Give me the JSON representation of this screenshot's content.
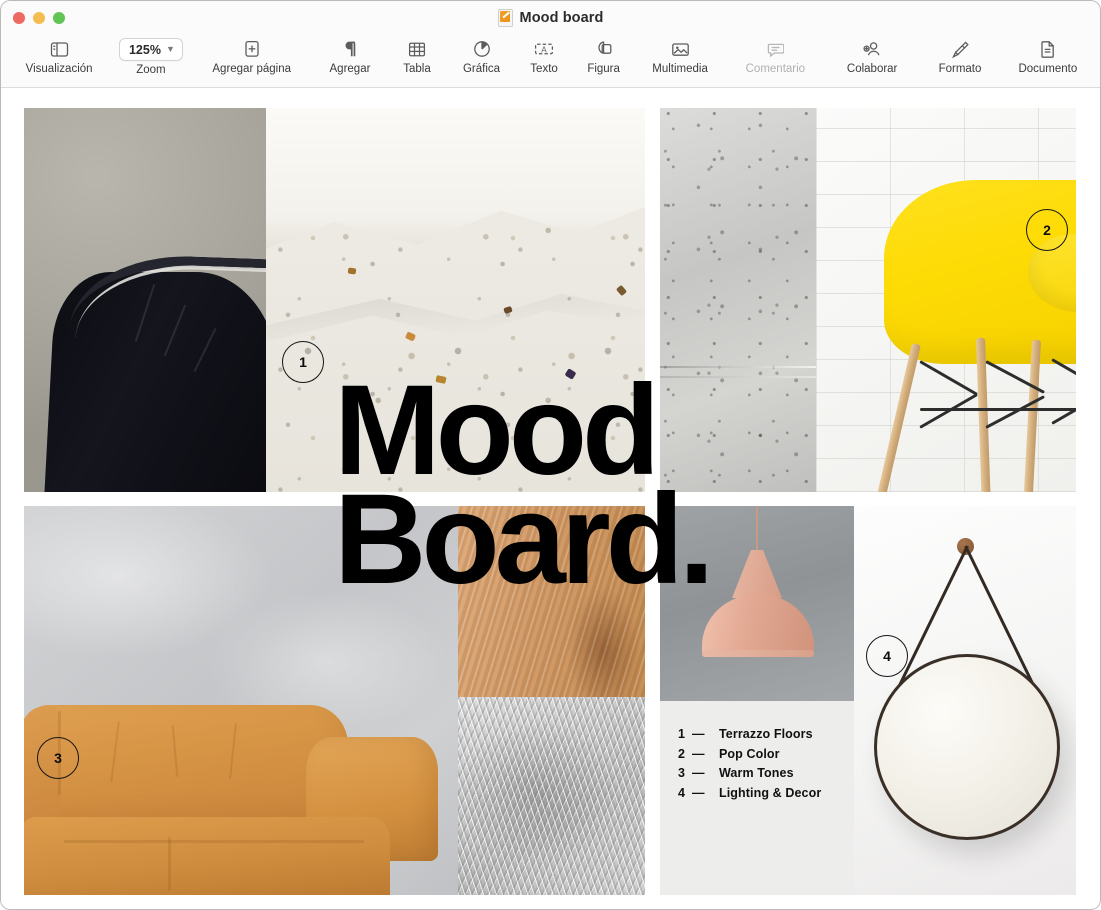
{
  "window": {
    "title": "Mood board",
    "doc_icon": "pages-document-icon",
    "controls": [
      {
        "name": "close",
        "color": "#ec6a5f"
      },
      {
        "name": "minimize",
        "color": "#f4bd50"
      },
      {
        "name": "zoom",
        "color": "#61c454"
      }
    ]
  },
  "toolbar": {
    "items": [
      {
        "label": "Visualización",
        "icon": "sidebar-icon",
        "type": "button",
        "disabled": false
      },
      {
        "label": "Zoom",
        "icon": "zoom-popup",
        "type": "popup",
        "value": "125%",
        "disabled": false
      },
      {
        "label": "Agregar página",
        "icon": "add-page-icon",
        "type": "button",
        "disabled": false
      },
      {
        "label": "Agregar",
        "icon": "pilcrow-icon",
        "type": "button",
        "disabled": false
      },
      {
        "label": "Tabla",
        "icon": "table-icon",
        "type": "button",
        "disabled": false
      },
      {
        "label": "Gráfica",
        "icon": "chart-pie-icon",
        "type": "button",
        "disabled": false
      },
      {
        "label": "Texto",
        "icon": "text-box-icon",
        "type": "button",
        "disabled": false
      },
      {
        "label": "Figura",
        "icon": "shapes-icon",
        "type": "button",
        "disabled": false
      },
      {
        "label": "Multimedia",
        "icon": "media-icon",
        "type": "button",
        "disabled": false
      },
      {
        "label": "Comentario",
        "icon": "comment-icon",
        "type": "button",
        "disabled": true
      },
      {
        "label": "Colaborar",
        "icon": "collaborate-icon",
        "type": "button",
        "disabled": false
      },
      {
        "label": "Formato",
        "icon": "format-brush-icon",
        "type": "button",
        "disabled": false
      },
      {
        "label": "Documento",
        "icon": "document-icon",
        "type": "button",
        "disabled": false
      }
    ]
  },
  "document": {
    "heading_line1": "Mood",
    "heading_line2": "Board.",
    "badges": [
      {
        "number": "1",
        "refers_to": "Terrazzo Floors"
      },
      {
        "number": "2",
        "refers_to": "Pop Color"
      },
      {
        "number": "3",
        "refers_to": "Warm Tones"
      },
      {
        "number": "4",
        "refers_to": "Lighting & Decor"
      }
    ],
    "legend": {
      "dash": "—",
      "rows": [
        {
          "num": "1",
          "label": "Terrazzo Floors"
        },
        {
          "num": "2",
          "label": "Pop Color"
        },
        {
          "num": "3",
          "label": "Warm Tones"
        },
        {
          "num": "4",
          "label": "Lighting & Decor"
        }
      ]
    },
    "images": [
      {
        "name": "black-leather-chair-photo",
        "alt": "Black leather armchair on grey background"
      },
      {
        "name": "terrazzo-slab-photo",
        "alt": "White terrazzo stone slab close-up"
      },
      {
        "name": "concrete-wall-photo",
        "alt": "Grey concrete wall texture"
      },
      {
        "name": "yellow-chair-photo",
        "alt": "Yellow moulded chair with wooden legs against white brick"
      },
      {
        "name": "grey-plaster-wall-photo",
        "alt": "Grey plaster wall"
      },
      {
        "name": "tan-leather-sofa-photo",
        "alt": "Tan leather sofa"
      },
      {
        "name": "wood-grain-photo",
        "alt": "Warm oak wood grain"
      },
      {
        "name": "grey-fur-rug-photo",
        "alt": "Grey sheepskin fur rug"
      },
      {
        "name": "pink-pendant-lamp-photo",
        "alt": "Blush pink pendant lamp on grey"
      },
      {
        "name": "round-strap-mirror-photo",
        "alt": "Round mirror with leather strap on white wall"
      }
    ]
  },
  "colors": {
    "pop_yellow": "#fcd905",
    "warm_tan": "#d1903f",
    "blush": "#e2a892",
    "legend_bg": "#ededec"
  }
}
